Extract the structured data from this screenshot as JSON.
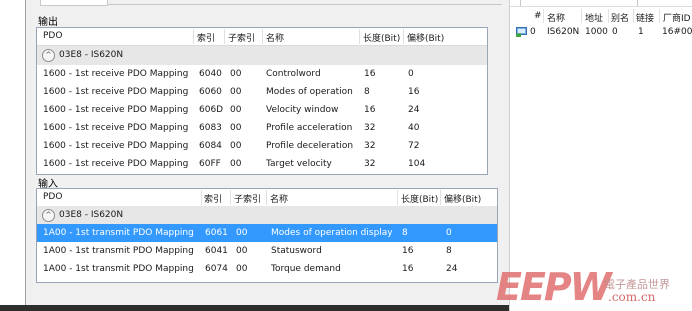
{
  "output_section": {
    "title": "输出",
    "columns": [
      "PDO",
      "索引",
      "子索引",
      "名称",
      "长度(Bit)",
      "偏移(Bit)"
    ],
    "group": {
      "label": "03E8 - IS620N",
      "expand_symbol": "^"
    },
    "rows": [
      [
        "1600 - 1st receive PDO Mapping",
        "6040",
        "00",
        "Controlword",
        "16",
        "0"
      ],
      [
        "1600 - 1st receive PDO Mapping",
        "6060",
        "00",
        "Modes of operation",
        "8",
        "16"
      ],
      [
        "1600 - 1st receive PDO Mapping",
        "606D",
        "00",
        "Velocity window",
        "16",
        "24"
      ],
      [
        "1600 - 1st receive PDO Mapping",
        "6083",
        "00",
        "Profile acceleration",
        "32",
        "40"
      ],
      [
        "1600 - 1st receive PDO Mapping",
        "6084",
        "00",
        "Profile deceleration",
        "32",
        "72"
      ],
      [
        "1600 - 1st receive PDO Mapping",
        "60FF",
        "00",
        "Target velocity",
        "32",
        "104"
      ]
    ]
  },
  "input_section": {
    "title": "输入",
    "columns": [
      "PDO",
      "索引",
      "子索引",
      "名称",
      "长度(Bit)",
      "偏移(Bit)"
    ],
    "group": {
      "label": "03E8 - IS620N",
      "expand_symbol": "^"
    },
    "rows": [
      [
        "1A00 - 1st transmit PDO Mapping",
        "6061",
        "00",
        "Modes of operation display",
        "8",
        "0"
      ],
      [
        "1A00 - 1st transmit PDO Mapping",
        "6041",
        "00",
        "Statusword",
        "16",
        "8"
      ],
      [
        "1A00 - 1st transmit PDO Mapping",
        "6074",
        "00",
        "Torque demand",
        "16",
        "24"
      ]
    ],
    "selected_row": 0
  },
  "device_list": {
    "columns": [
      "#",
      "名称",
      "地址",
      "别名",
      "链接",
      "厂商ID"
    ],
    "rows": [
      [
        "0",
        "IS620N",
        "1000",
        "0",
        "1",
        "16#00"
      ]
    ],
    "row_icon": "network-device-icon"
  },
  "watermark": {
    "logo": "EEPW",
    "chinese": "電子產品世界",
    "url": ".com.cn"
  },
  "colors": {
    "selection": "#3399ff",
    "group_bg": "#e7e7e7",
    "panel_bg": "#f0f0f0",
    "grid_border": "#9aa6b8"
  }
}
